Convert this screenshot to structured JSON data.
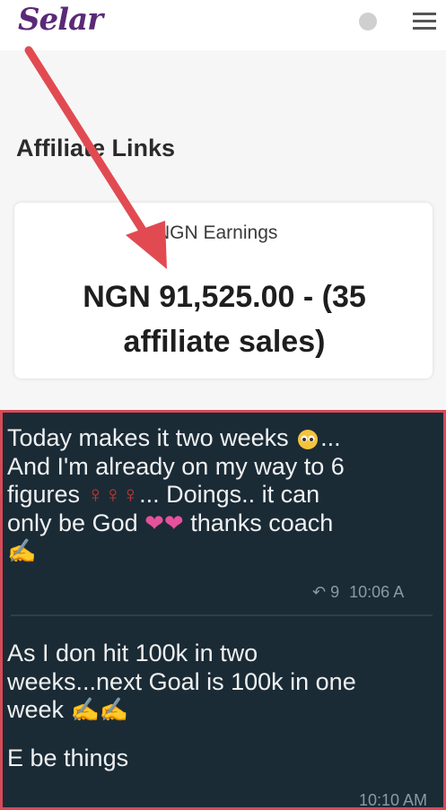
{
  "header": {
    "logo_text": "Selar",
    "menu_icon": "hamburger-icon",
    "status_icon": "dot-icon"
  },
  "page": {
    "section_title": "Affiliate Links",
    "earnings_label": "NGN Earnings",
    "earnings_line1": "NGN 91,525.00 - (35",
    "earnings_line2": "affiliate sales)"
  },
  "chat": {
    "msg1": {
      "line1": "Today makes it two weeks",
      "line1_end": "...",
      "line2": "And I'm already on my way to 6",
      "line3_a": "figures",
      "line3_b": "... Doings.. it can",
      "line4_a": "only be God",
      "line4_b": "thanks coach",
      "forward_count": "9",
      "time": "10:06 A"
    },
    "msg2": {
      "line1": "As I don hit 100k in two",
      "line2": "weeks...next Goal is 100k in one",
      "line3": "week",
      "line4": "E be things",
      "time": "10:10 AM"
    }
  },
  "colors": {
    "brand": "#5a2a78",
    "annotation": "#d84a57",
    "chat_bg": "#1a2b36"
  }
}
